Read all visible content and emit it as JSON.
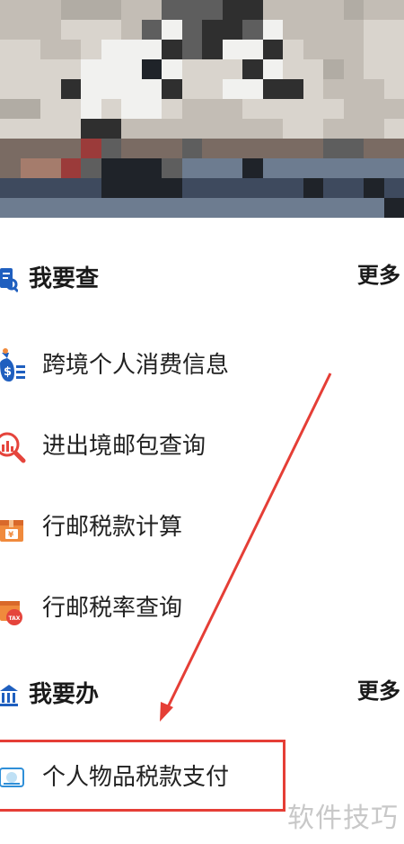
{
  "banner": {
    "description_colors": [
      "#c9c4bd",
      "#b7b2aa",
      "#e0dcd5",
      "#5a5a5a",
      "#2e2e2e",
      "#f2f2f2",
      "#d8d2cb",
      "#7a6b63",
      "#9b3b3a",
      "#3e4a5e",
      "#6d7c90",
      "#2a2a2a"
    ]
  },
  "query_section": {
    "title": "我要查",
    "more_label": "更多",
    "icon": "search-document-icon",
    "items": [
      {
        "label": "跨境个人消费信息",
        "icon": "money-bag-list-icon"
      },
      {
        "label": "进出境邮包查询",
        "icon": "magnifier-chart-icon"
      },
      {
        "label": "行邮税款计算",
        "icon": "parcel-yen-icon"
      },
      {
        "label": "行邮税率查询",
        "icon": "parcel-tax-icon"
      }
    ]
  },
  "handle_section": {
    "title": "我要办",
    "more_label": "更多",
    "icon": "bank-building-icon",
    "items": [
      {
        "label": "个人物品税款支付",
        "icon": "payment-card-icon"
      }
    ]
  },
  "watermark": "软件技巧",
  "colors": {
    "accent_blue": "#1f5fbf",
    "accent_orange": "#f08a3c",
    "accent_red": "#e53e36",
    "annotation_red": "#e53e36"
  }
}
